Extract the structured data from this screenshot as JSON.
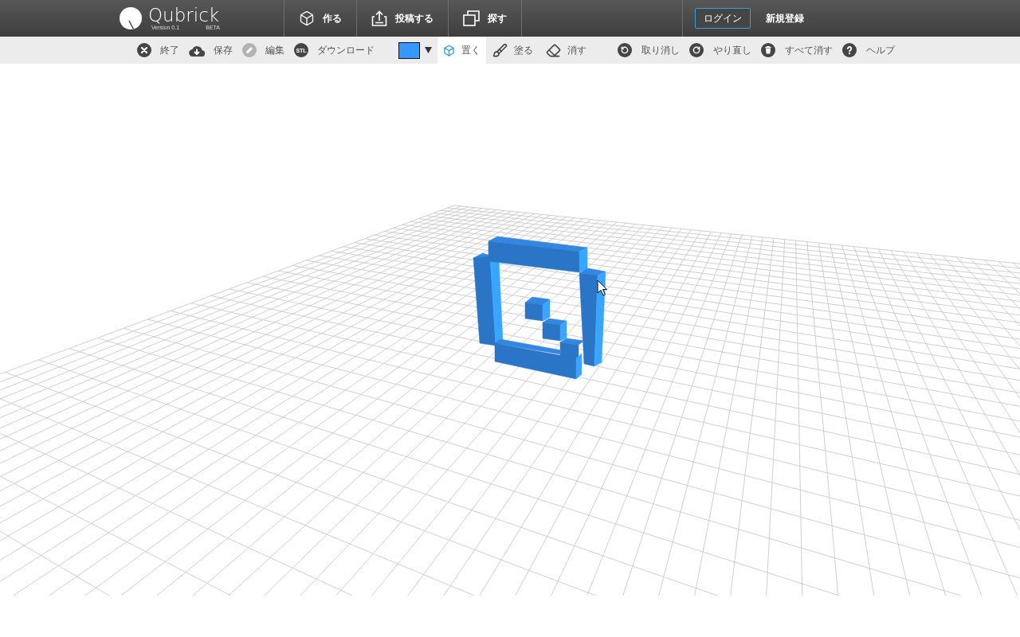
{
  "header": {
    "logo": {
      "name": "Qubrick",
      "version": "Version 0.1",
      "badge": "BETA"
    },
    "nav": [
      {
        "label": "作る"
      },
      {
        "label": "投稿する"
      },
      {
        "label": "探す"
      }
    ],
    "account": {
      "login": "ログイン",
      "signup": "新規登録"
    }
  },
  "toolbar": {
    "file_actions": [
      {
        "label": "終了",
        "disabled": false
      },
      {
        "label": "保存",
        "disabled": false
      },
      {
        "label": "編集",
        "disabled": true
      },
      {
        "label": "ダウンロード",
        "disabled": false,
        "badge": "STL"
      }
    ],
    "color_picker": {
      "color": "#3399ff"
    },
    "modes": [
      {
        "label": "置く",
        "selected": true
      },
      {
        "label": "塗る",
        "selected": false
      },
      {
        "label": "消す",
        "selected": false
      }
    ],
    "history": [
      {
        "label": "取り消し"
      },
      {
        "label": "やり直し"
      },
      {
        "label": "すべて消す"
      },
      {
        "label": "ヘルプ"
      }
    ]
  }
}
